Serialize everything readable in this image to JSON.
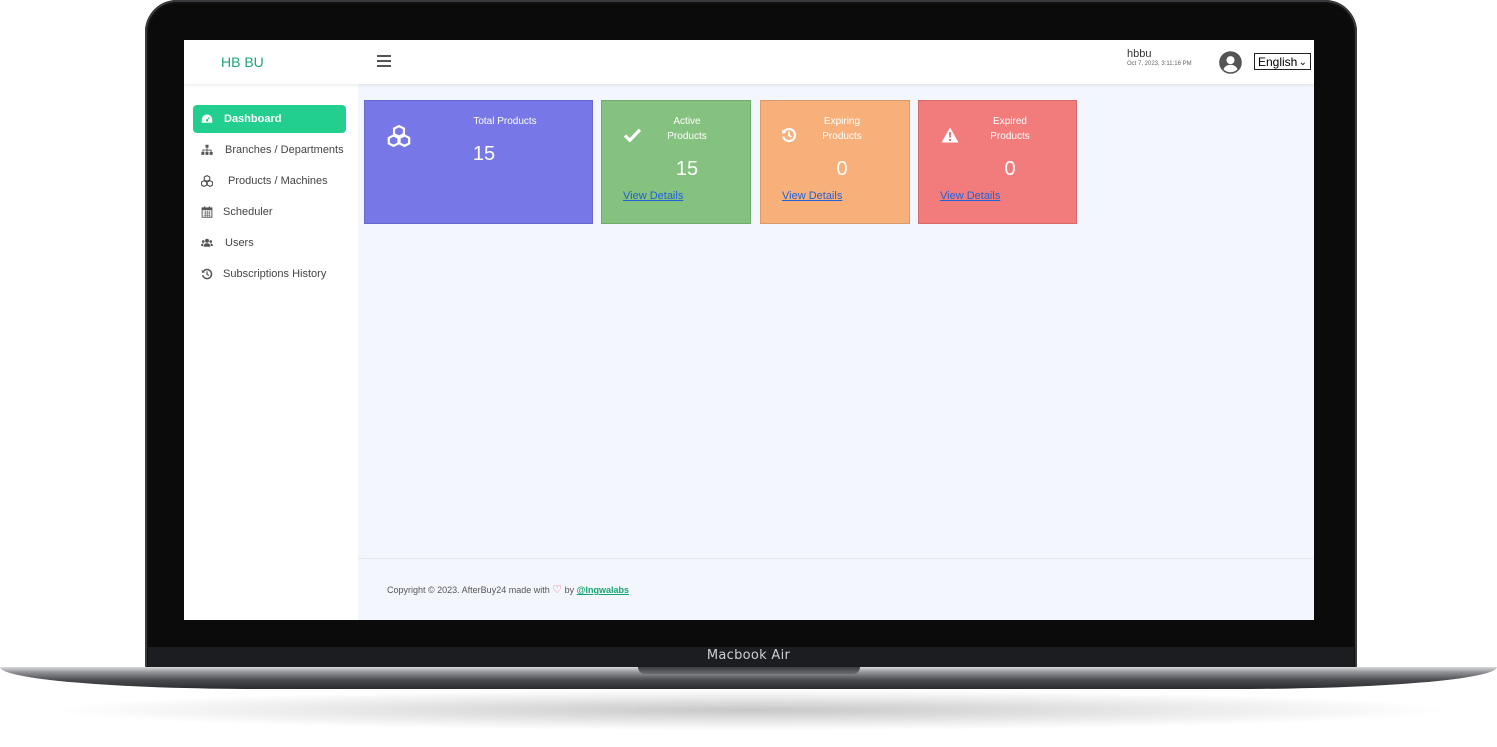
{
  "device": {
    "label": "Macbook Air"
  },
  "app": {
    "logo": "HB BU"
  },
  "header": {
    "username": "hbbu",
    "timestamp": "Oct 7, 2023, 3:11:16 PM",
    "language": "English"
  },
  "sidebar": {
    "items": [
      {
        "label": "Dashboard",
        "icon": "dashboard-gauge-icon",
        "active": true
      },
      {
        "label": "Branches / Departments",
        "icon": "sitemap-icon"
      },
      {
        "label": "Products / Machines",
        "icon": "cubes-icon"
      },
      {
        "label": "Scheduler",
        "icon": "calendar-icon"
      },
      {
        "label": "Users",
        "icon": "users-icon"
      },
      {
        "label": "Subscriptions History",
        "icon": "history-icon"
      }
    ]
  },
  "cards": [
    {
      "title": "Total Products",
      "value": "15",
      "icon": "cubes-icon",
      "color": "#7877e8"
    },
    {
      "title_line1": "Active",
      "title_line2": "Products",
      "value": "15",
      "link": "View Details",
      "icon": "check-icon",
      "color": "#85c17f"
    },
    {
      "title_line1": "Expiring",
      "title_line2": "Products",
      "value": "0",
      "link": "View Details",
      "icon": "history-icon",
      "color": "#f8b07b"
    },
    {
      "title_line1": "Expired",
      "title_line2": "Products",
      "value": "0",
      "link": "View Details",
      "icon": "warning-icon",
      "color": "#f27b7b"
    }
  ],
  "footer": {
    "text": "Copyright © 2023. AfterBuy24 made with",
    "heart": "♡",
    "by": "by",
    "link": "@lngwalabs"
  }
}
